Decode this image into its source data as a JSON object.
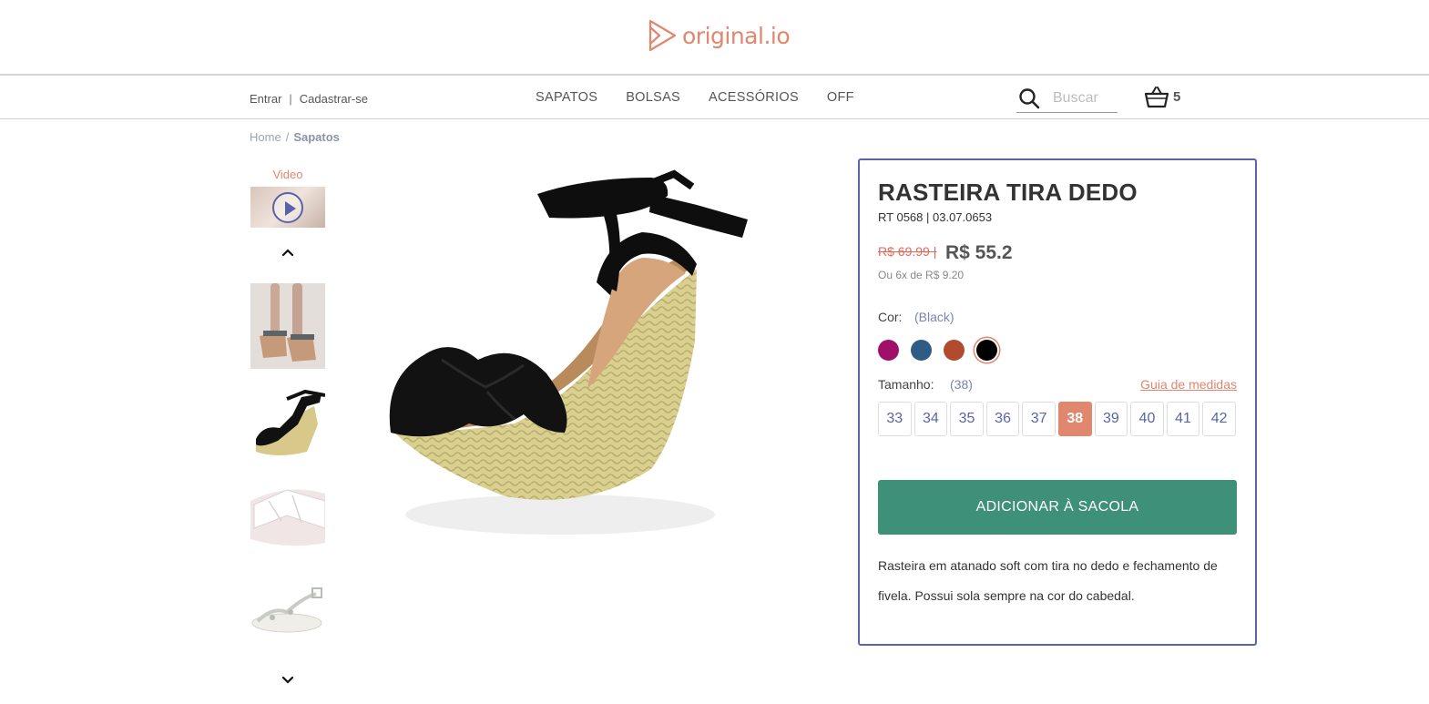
{
  "brand": {
    "name": "original.io",
    "color": "#e0876e"
  },
  "auth": {
    "login": "Entrar",
    "separator": "|",
    "register": "Cadastrar-se"
  },
  "nav": {
    "items": [
      "SAPATOS",
      "BOLSAS",
      "ACESSÓRIOS",
      "OFF"
    ]
  },
  "search": {
    "placeholder": "Buscar",
    "icon": "search-icon"
  },
  "cart": {
    "count": "5",
    "icon": "basket-icon"
  },
  "breadcrumb": {
    "home": "Home",
    "separator": "/",
    "current": "Sapatos"
  },
  "gallery": {
    "video_label": "Video",
    "thumbnails": [
      "legs-wearing-wedge",
      "black-wedge-sandal",
      "white-flat-sandal",
      "silver-flat-sandal"
    ]
  },
  "product": {
    "title": "RASTEIRA TIRA DEDO",
    "sku": "RT 0568 | 03.07.0653",
    "old_price": "R$ 69.99 |",
    "price": "R$ 55.2",
    "installments": "Ou 6x de R$ 9.20",
    "color_label": "Cor:",
    "color_value": "(Black)",
    "colors": [
      {
        "name": "magenta",
        "hex": "#a0106a"
      },
      {
        "name": "blue",
        "hex": "#2f5c85"
      },
      {
        "name": "brown",
        "hex": "#b24a2d"
      },
      {
        "name": "black",
        "hex": "#000000",
        "selected": true
      }
    ],
    "size_label": "Tamanho:",
    "size_value": "(38)",
    "size_guide": "Guia de medidas",
    "sizes": [
      "33",
      "34",
      "35",
      "36",
      "37",
      "38",
      "39",
      "40",
      "41",
      "42"
    ],
    "selected_size": "38",
    "add_to_bag": "ADICIONAR À SACOLA",
    "description": "Rasteira em atanado soft com tira no dedo e fechamento de fivela. Possui sola sempre na cor do cabedal."
  }
}
